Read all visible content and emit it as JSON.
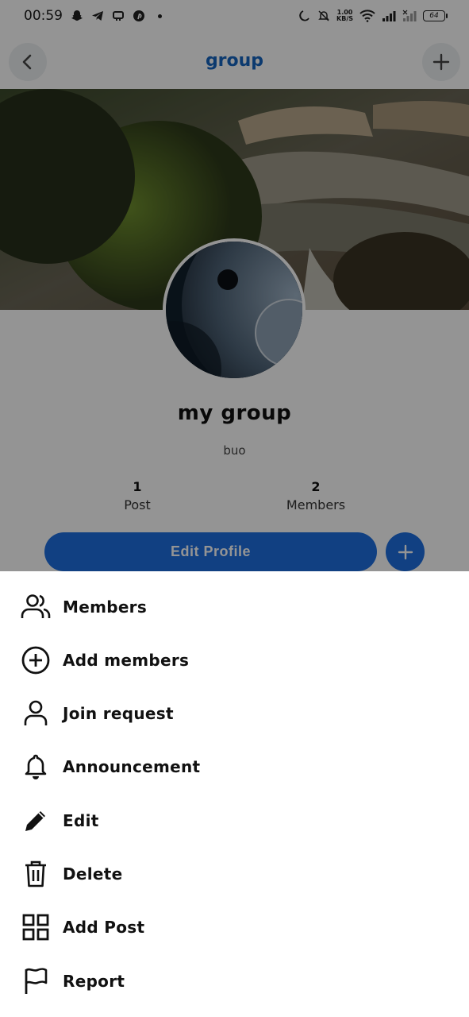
{
  "status_bar": {
    "time": "00:59",
    "net_speed_value": "1.00",
    "net_speed_unit": "KB/S",
    "battery": "64"
  },
  "app_bar": {
    "title": "group"
  },
  "profile": {
    "name": "my group",
    "description": "buo",
    "stats": [
      {
        "value": "1",
        "label": "Post"
      },
      {
        "value": "2",
        "label": "Members"
      }
    ],
    "edit_button_label": "Edit Profile"
  },
  "menu": {
    "items": [
      {
        "label": "Members",
        "icon": "members-icon"
      },
      {
        "label": "Add members",
        "icon": "add-circle-icon"
      },
      {
        "label": "Join request",
        "icon": "person-icon"
      },
      {
        "label": "Announcement",
        "icon": "bell-icon"
      },
      {
        "label": "Edit",
        "icon": "pencil-icon"
      },
      {
        "label": "Delete",
        "icon": "trash-icon"
      },
      {
        "label": "Add Post",
        "icon": "grid-icon"
      },
      {
        "label": "Report",
        "icon": "flag-icon"
      }
    ]
  },
  "colors": {
    "accent": "#1e6fe0",
    "title": "#1565c0",
    "scrim": "rgba(0,0,0,0.42)"
  }
}
